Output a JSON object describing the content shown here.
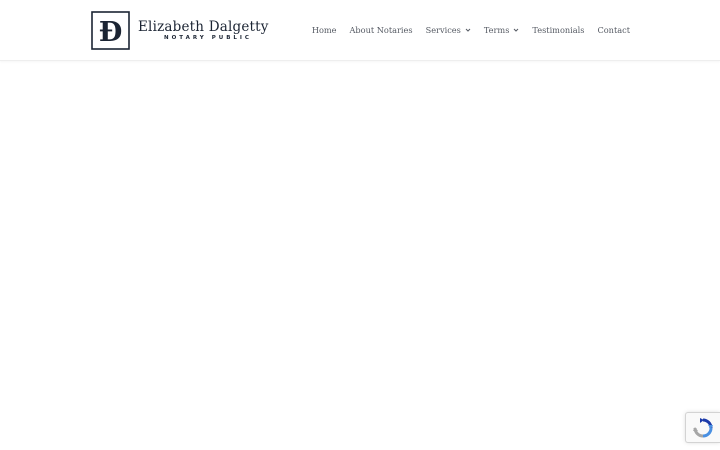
{
  "logo": {
    "monogram": "ED",
    "name": "Elizabeth Dalgetty",
    "subtitle": "NOTARY PUBLIC"
  },
  "nav": {
    "items": [
      {
        "label": "Home",
        "has_dropdown": false
      },
      {
        "label": "About Notaries",
        "has_dropdown": false
      },
      {
        "label": "Services",
        "has_dropdown": true
      },
      {
        "label": "Terms",
        "has_dropdown": true
      },
      {
        "label": "Testimonials",
        "has_dropdown": false
      },
      {
        "label": "Contact",
        "has_dropdown": false
      }
    ]
  },
  "widgets": {
    "recaptcha_icon": "recaptcha-icon"
  },
  "colors": {
    "brand_navy": "#1b2433",
    "nav_text": "#555a63",
    "background": "#ffffff"
  }
}
